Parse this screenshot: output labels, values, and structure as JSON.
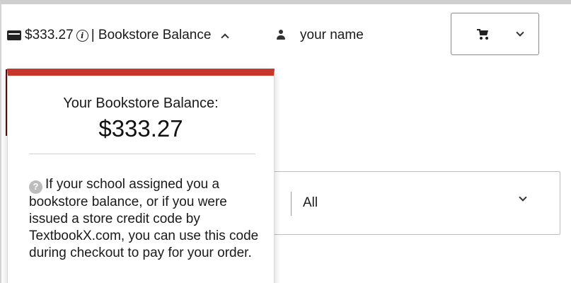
{
  "header": {
    "balance_amount": "$333.27",
    "balance_separator": "| Bookstore Balance",
    "user_name": "your name",
    "icons": [
      "card-icon",
      "info-icon",
      "chevron-up-icon",
      "person-icon",
      "cart-icon",
      "chevron-down-icon"
    ]
  },
  "balance_popup": {
    "heading": "Your Bookstore Balance:",
    "amount": "$333.27",
    "help_mark": "?",
    "description": "If your school assigned you a bookstore balance, or if you were issued a store credit code by TextbookX.com, you can use this code during checkout to pay for your order.",
    "accent_color": "#c6362b"
  },
  "filter": {
    "selected": "All"
  }
}
